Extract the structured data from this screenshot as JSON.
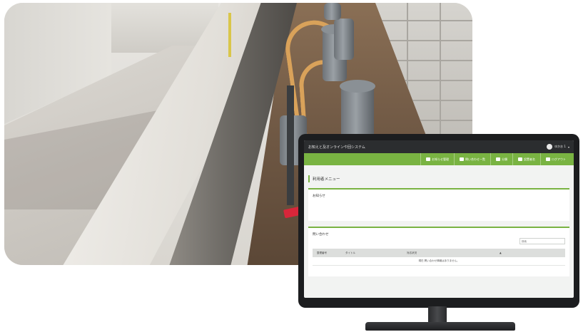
{
  "app": {
    "title": "お知えと及オンラインや回システム",
    "user_name": "ゆかお 1",
    "caret": "▾"
  },
  "nav": [
    {
      "label": "お知らせ管理",
      "icon": "people-icon"
    },
    {
      "label": "問い合わせ一覧",
      "icon": "mail-icon"
    },
    {
      "label": "分類",
      "icon": "people-icon"
    },
    {
      "label": "設置者名",
      "icon": "document-icon"
    },
    {
      "label": "ログアウト",
      "icon": "logout-icon"
    }
  ],
  "page": {
    "title": "利用者メニュー"
  },
  "notice": {
    "heading": "お知らせ"
  },
  "inquiry": {
    "heading": "問い合わせ",
    "search_placeholder": "検索",
    "columns": {
      "id": "整理番号",
      "subject": "タイトル",
      "status": "対応状況",
      "sort": "▲"
    },
    "empty_message": "現在 問い合わせ情報はありません。"
  },
  "colors": {
    "accent": "#79b342",
    "topbar": "#2b2d2f"
  }
}
